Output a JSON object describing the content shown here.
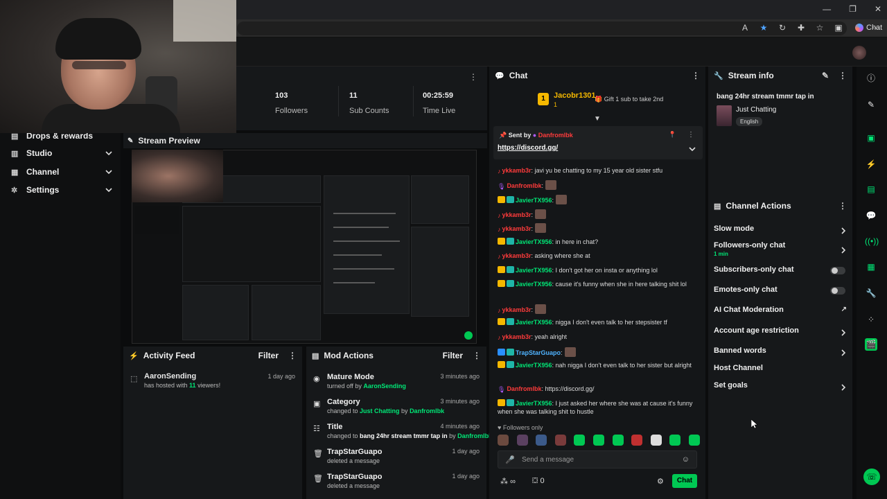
{
  "browser": {
    "window_controls": [
      "—",
      "❐",
      "✕"
    ],
    "chat_button": "Chat"
  },
  "sidebar": {
    "items": [
      {
        "label": "Drops & rewards",
        "icon": "gift-icon"
      },
      {
        "label": "Studio",
        "icon": "studio-icon"
      },
      {
        "label": "Channel",
        "icon": "channel-icon"
      },
      {
        "label": "Settings",
        "icon": "gear-icon"
      }
    ]
  },
  "stats": {
    "followers_value": "103",
    "followers_label": "Followers",
    "subs_value": "11",
    "subs_label": "Sub Counts",
    "time_value": "00:25:59",
    "time_label": "Time Live"
  },
  "preview": {
    "title": "Stream Preview"
  },
  "activity": {
    "title": "Activity Feed",
    "filter": "Filter",
    "items": [
      {
        "user": "AaronSending",
        "text_pre": "has hosted with ",
        "count": "11",
        "text_post": " viewers!",
        "time": "1 day ago"
      }
    ]
  },
  "mod": {
    "title": "Mod Actions",
    "filter": "Filter",
    "items": [
      {
        "title": "Mature Mode",
        "sub_pre": "turned off by ",
        "sub_hl": "AaronSending",
        "sub_mid": "",
        "sub_hl2": "",
        "time": "3 minutes ago",
        "icon": "eye-icon"
      },
      {
        "title": "Category",
        "sub_pre": "changed to ",
        "sub_hl": "Just Chatting",
        "sub_mid": " by ",
        "sub_hl2": "Danfromlbk",
        "time": "3 minutes ago",
        "icon": "category-icon"
      },
      {
        "title": "Title",
        "sub_pre": "changed to ",
        "sub_hl": "bang 24hr stream tmmr tap in",
        "sub_mid": " by ",
        "sub_hl2": "Danfromlbk",
        "time": "4 minutes ago",
        "icon": "title-icon"
      },
      {
        "title": "TrapStarGuapo",
        "sub_pre": "deleted a message",
        "sub_hl": "",
        "sub_mid": "",
        "sub_hl2": "",
        "time": "1 day ago",
        "icon": "trash-icon"
      },
      {
        "title": "TrapStarGuapo",
        "sub_pre": "deleted a message",
        "sub_hl": "",
        "sub_mid": "",
        "sub_hl2": "",
        "time": "1 day ago",
        "icon": "trash-icon"
      }
    ]
  },
  "chat": {
    "title": "Chat",
    "top_gifter": "Jacobr1301",
    "top_gifter_count": "1",
    "gift_text": "Gift 1 sub to take 2nd",
    "pinned_label": "Sent by",
    "pinned_user": "Danfromlbk",
    "pinned_link": "https://discord.gg/",
    "followers_only": "Followers only",
    "input_placeholder": "Send a message",
    "infinity": "∞",
    "gift_count": "0",
    "send_button": "Chat",
    "messages": [
      {
        "badges": [
          "red"
        ],
        "user": "ykkamb3r",
        "ucls": "u-red",
        "text": ": javi yu be chatting to my 15 year old sister stfu",
        "emote": false
      },
      {
        "badges": [
          "mic"
        ],
        "user": "Danfromlbk",
        "ucls": "u-red",
        "text": ":",
        "emote": true
      },
      {
        "badges": [
          "crown",
          "sub"
        ],
        "user": "JavierTX956",
        "ucls": "u-grn",
        "text": ":",
        "emote": true
      },
      {
        "badges": [
          "red"
        ],
        "user": "ykkamb3r",
        "ucls": "u-red",
        "text": ":",
        "emote": true
      },
      {
        "badges": [
          "red"
        ],
        "user": "ykkamb3r",
        "ucls": "u-red",
        "text": ":",
        "emote": true
      },
      {
        "badges": [
          "crown",
          "sub"
        ],
        "user": "JavierTX956",
        "ucls": "u-grn",
        "text": ": in here in chat?",
        "emote": false
      },
      {
        "badges": [
          "red"
        ],
        "user": "ykkamb3r",
        "ucls": "u-red",
        "text": ": asking where she at",
        "emote": false
      },
      {
        "badges": [
          "crown",
          "sub"
        ],
        "user": "JavierTX956",
        "ucls": "u-grn",
        "text": ": I don't got her on insta or anything lol",
        "emote": false
      },
      {
        "badges": [
          "crown",
          "sub"
        ],
        "user": "JavierTX956",
        "ucls": "u-grn",
        "text": ": cause it's funny when she in here talking shit lol",
        "emote": false
      },
      {
        "badges": [
          "red"
        ],
        "user": "ykkamb3r",
        "ucls": "u-red",
        "text": ":",
        "emote": true
      },
      {
        "badges": [
          "crown",
          "sub"
        ],
        "user": "JavierTX956",
        "ucls": "u-grn",
        "text": ": nigga I don't even talk to her stepsister tf",
        "emote": false
      },
      {
        "badges": [
          "red"
        ],
        "user": "ykkamb3r",
        "ucls": "u-red",
        "text": ": yeah alright",
        "emote": false
      },
      {
        "badges": [
          "blue",
          "sub"
        ],
        "user": "TrapStarGuapo",
        "ucls": "u-blu",
        "text": ":",
        "emote": true
      },
      {
        "badges": [
          "crown",
          "sub"
        ],
        "user": "JavierTX956",
        "ucls": "u-grn",
        "text": ": nah nigga I don't even talk to her sister but alright",
        "emote": false
      },
      {
        "badges": [
          "mic"
        ],
        "user": "Danfromlbk",
        "ucls": "u-red",
        "text": ": https://discord.gg/",
        "emote": false
      },
      {
        "badges": [
          "crown",
          "sub"
        ],
        "user": "JavierTX956",
        "ucls": "u-grn",
        "text": ": I just asked her where she was at cause it's funny when she was talking shit to hustle",
        "emote": false
      }
    ]
  },
  "info": {
    "title": "Stream info",
    "stream_title": "bang 24hr stream tmmr tap in",
    "category": "Just Chatting",
    "language": "English"
  },
  "actions": {
    "title": "Channel Actions",
    "items": [
      {
        "label": "Slow mode",
        "sub": "",
        "kind": "chevron"
      },
      {
        "label": "Followers-only chat",
        "sub": "1 min",
        "kind": "chevron"
      },
      {
        "label": "Subscribers-only chat",
        "sub": "",
        "kind": "toggle"
      },
      {
        "label": "Emotes-only chat",
        "sub": "",
        "kind": "toggle"
      },
      {
        "label": "AI Chat Moderation",
        "sub": "",
        "kind": "external"
      },
      {
        "label": "Account age restriction",
        "sub": "",
        "kind": "chevron"
      },
      {
        "label": "Banned words",
        "sub": "",
        "kind": "chevron"
      },
      {
        "label": "Host Channel",
        "sub": "",
        "kind": "none"
      },
      {
        "label": "Set goals",
        "sub": "",
        "kind": "chevron"
      }
    ]
  },
  "colors": {
    "accent": "#00e676",
    "background": "#0b0c0d",
    "panel": "#16181a"
  }
}
